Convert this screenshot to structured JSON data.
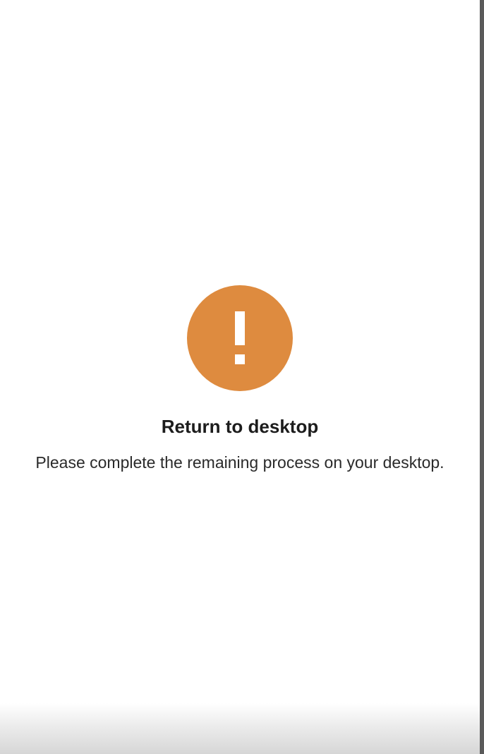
{
  "colors": {
    "accent": "#DE8B3F",
    "background": "#FFFFFF"
  },
  "alert": {
    "icon": "exclamation-icon",
    "title": "Return to desktop",
    "message": "Please complete the remaining process on your desktop."
  }
}
